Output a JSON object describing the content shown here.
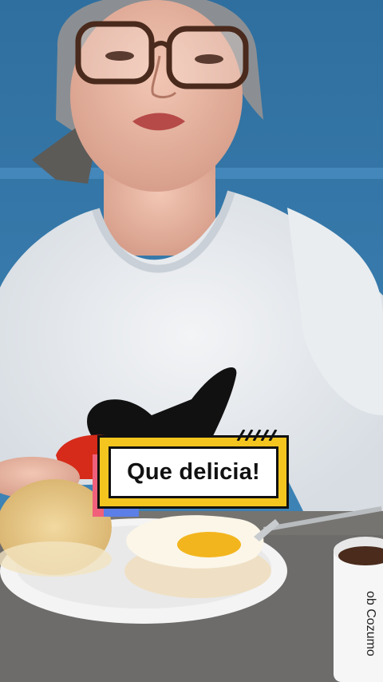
{
  "overlay": {
    "caption": "Que delicia!",
    "colors": {
      "frame": "#f4c51f",
      "accent_pink": "#f0607a",
      "accent_blue": "#5b7fe6",
      "text": "#111111"
    }
  },
  "scene": {
    "mug_text": "ob Cozumo"
  }
}
